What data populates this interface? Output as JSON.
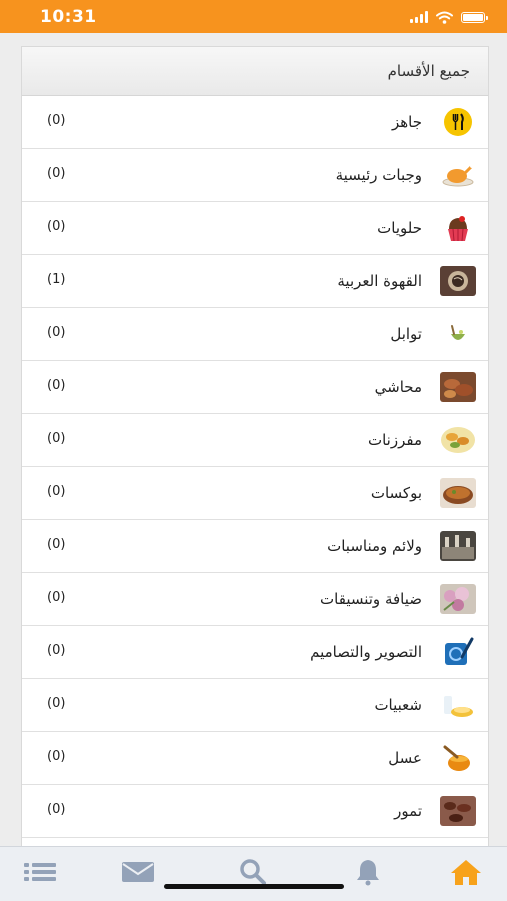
{
  "status_bar": {
    "time": "10:31"
  },
  "header": {
    "title": "جميع الأقسام"
  },
  "categories": [
    {
      "name": "جاهز",
      "count": "(0)",
      "icon": "fork-knife-icon"
    },
    {
      "name": "وجبات رئيسية",
      "count": "(0)",
      "icon": "roast-chicken-icon"
    },
    {
      "name": "حلويات",
      "count": "(0)",
      "icon": "cupcake-icon"
    },
    {
      "name": "القهوة العربية",
      "count": "(1)",
      "icon": "coffee-photo-icon"
    },
    {
      "name": "توابل",
      "count": "(0)",
      "icon": "spice-bowl-icon"
    },
    {
      "name": "محاشي",
      "count": "(0)",
      "icon": "stuffed-food-photo-icon"
    },
    {
      "name": "مفرزنات",
      "count": "(0)",
      "icon": "frozen-food-icon"
    },
    {
      "name": "بوكسات",
      "count": "(0)",
      "icon": "box-meal-icon"
    },
    {
      "name": "ولائم ومناسبات",
      "count": "(0)",
      "icon": "banquet-photo-icon"
    },
    {
      "name": "ضيافة وتنسيقات",
      "count": "(0)",
      "icon": "flowers-photo-icon"
    },
    {
      "name": "التصوير والتصاميم",
      "count": "(0)",
      "icon": "design-pen-icon"
    },
    {
      "name": "شعبيات",
      "count": "(0)",
      "icon": "traditional-food-icon"
    },
    {
      "name": "عسل",
      "count": "(0)",
      "icon": "honey-icon"
    },
    {
      "name": "تمور",
      "count": "(0)",
      "icon": "dates-photo-icon"
    }
  ],
  "tab_bar": {
    "tabs": [
      {
        "icon": "list-icon"
      },
      {
        "icon": "mail-icon"
      },
      {
        "icon": "search-icon"
      },
      {
        "icon": "bell-icon"
      },
      {
        "icon": "home-icon",
        "active": true
      }
    ],
    "inactive_color": "#93a2b8",
    "active_color": "#f7a21b"
  },
  "colors": {
    "status_bar": "#f7931e"
  }
}
